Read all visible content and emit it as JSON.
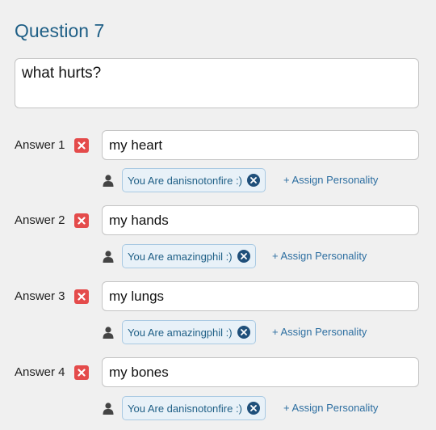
{
  "question": {
    "title": "Question 7",
    "text": "what hurts?"
  },
  "answers": [
    {
      "label": "Answer 1",
      "value": "my heart",
      "personality": "You Are danisnotonfire :)",
      "assign_label": "+ Assign Personality"
    },
    {
      "label": "Answer 2",
      "value": "my hands",
      "personality": "You Are amazingphil :)",
      "assign_label": "+ Assign Personality"
    },
    {
      "label": "Answer 3",
      "value": "my lungs",
      "personality": "You Are amazingphil :)",
      "assign_label": "+ Assign Personality"
    },
    {
      "label": "Answer 4",
      "value": "my bones",
      "personality": "You Are danisnotonfire :)",
      "assign_label": "+ Assign Personality"
    }
  ],
  "icons": {
    "delete": "close-x-icon",
    "personality": "person-icon",
    "remove_tag": "circle-x-icon"
  },
  "colors": {
    "title": "#1f5f86",
    "delete_button": "#e44b4b",
    "tag_background": "#e8f1f8",
    "tag_close": "#1f4f7a",
    "link": "#2e6fa1",
    "page_background": "#f0f0f0"
  }
}
